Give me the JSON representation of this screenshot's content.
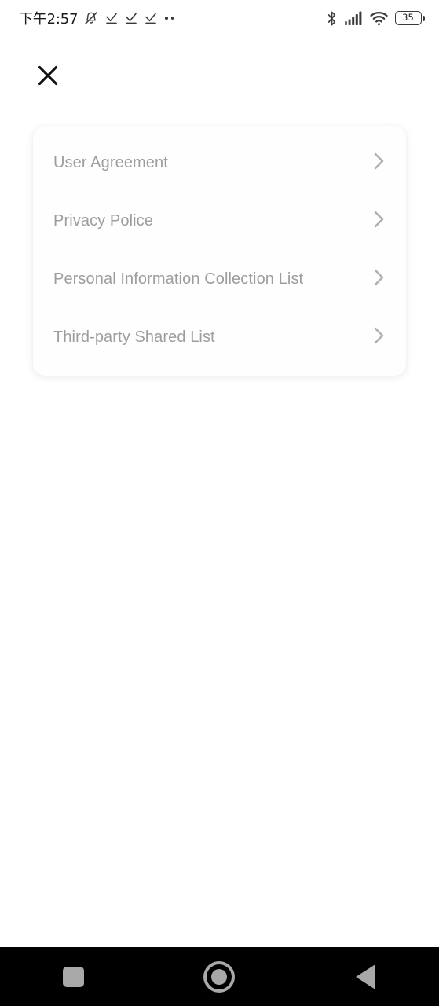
{
  "status_bar": {
    "time": "下午2:57",
    "left_icons": [
      {
        "name": "bell-muted-icon"
      },
      {
        "name": "check-download-icon-1"
      },
      {
        "name": "check-download-icon-2"
      },
      {
        "name": "check-download-icon-3"
      },
      {
        "name": "more-dots-icon"
      }
    ],
    "right_icons": [
      {
        "name": "bluetooth-icon"
      },
      {
        "name": "cellular-signal-icon"
      },
      {
        "name": "wifi-icon"
      }
    ],
    "battery": {
      "name": "battery-icon",
      "level": "35"
    }
  },
  "header": {
    "close_icon": "close-icon"
  },
  "card": {
    "rows": [
      {
        "label": "User Agreement",
        "icon": "chevron-right-icon"
      },
      {
        "label": "Privacy Police",
        "icon": "chevron-right-icon"
      },
      {
        "label": "Personal Information Collection List",
        "icon": "chevron-right-icon"
      },
      {
        "label": "Third-party Shared List",
        "icon": "chevron-right-icon"
      }
    ]
  },
  "nav_bar": {
    "recents": {
      "name": "recents-square-icon"
    },
    "home": {
      "name": "home-circle-icon"
    },
    "back": {
      "name": "back-triangle-icon"
    }
  },
  "colors": {
    "page_background": "#ffffff",
    "card_background": "#fefefe",
    "row_text": "#9d9d9d",
    "chevron": "#b0b0b0",
    "status_text": "#1c1c1c",
    "nav_background": "#000000",
    "nav_icon": "#a8a8a8"
  }
}
